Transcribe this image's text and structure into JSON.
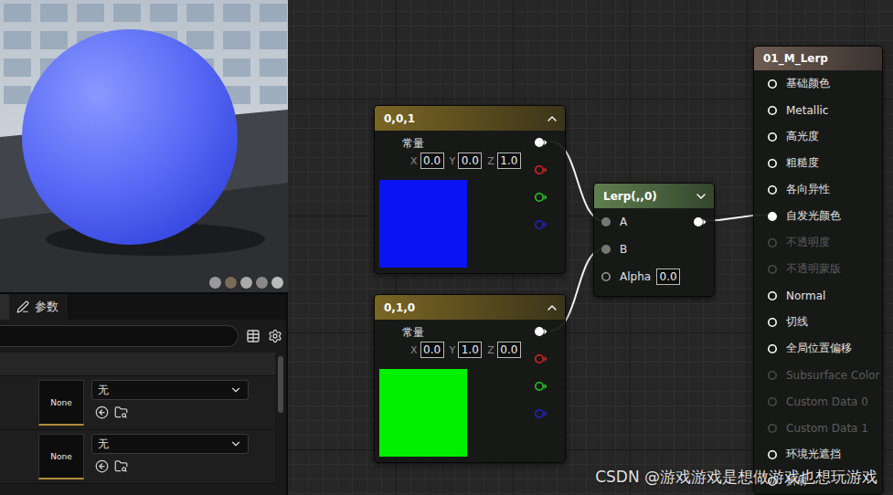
{
  "details": {
    "tabs": [
      {
        "label": "参数",
        "selected": true
      }
    ],
    "rows": [
      {
        "thumbnail": "None",
        "value": "无"
      },
      {
        "thumbnail": "None",
        "value": "无"
      }
    ]
  },
  "graph": {
    "constants": [
      {
        "title": "0,0,1",
        "expanded": true,
        "label": "常量",
        "fields": [
          {
            "axis": "X",
            "value": "0.0"
          },
          {
            "axis": "Y",
            "value": "0.0"
          },
          {
            "axis": "Z",
            "value": "1.0"
          }
        ],
        "color": "#0a14f2"
      },
      {
        "title": "0,1,0",
        "expanded": true,
        "label": "常量",
        "fields": [
          {
            "axis": "X",
            "value": "0.0"
          },
          {
            "axis": "Y",
            "value": "1.0"
          },
          {
            "axis": "Z",
            "value": "0.0"
          }
        ],
        "color": "#00f000"
      }
    ],
    "lerp": {
      "title": "Lerp(,,0)",
      "expanded": false,
      "inputs": [
        {
          "label": "A",
          "connected": true
        },
        {
          "label": "B",
          "connected": true
        },
        {
          "label": "Alpha",
          "connected": false,
          "value": "0.0"
        }
      ]
    },
    "material": {
      "title": "01_M_Lerp",
      "pins": [
        {
          "label": "基础颜色",
          "disabled": false,
          "connected": false
        },
        {
          "label": "Metallic",
          "disabled": false,
          "connected": false
        },
        {
          "label": "高光度",
          "disabled": false,
          "connected": false
        },
        {
          "label": "粗糙度",
          "disabled": false,
          "connected": false
        },
        {
          "label": "各向异性",
          "disabled": false,
          "connected": false
        },
        {
          "label": "自发光颜色",
          "disabled": false,
          "connected": true
        },
        {
          "label": "不透明度",
          "disabled": true,
          "connected": false
        },
        {
          "label": "不透明蒙版",
          "disabled": true,
          "connected": false
        },
        {
          "label": "Normal",
          "disabled": false,
          "connected": false
        },
        {
          "label": "切线",
          "disabled": false,
          "connected": false
        },
        {
          "label": "全局位置偏移",
          "disabled": false,
          "connected": false
        },
        {
          "label": "Subsurface Color",
          "disabled": true,
          "connected": false
        },
        {
          "label": "Custom Data 0",
          "disabled": true,
          "connected": false
        },
        {
          "label": "Custom Data 1",
          "disabled": true,
          "connected": false
        },
        {
          "label": "环境光遮挡",
          "disabled": false,
          "connected": false
        },
        {
          "label": "折射",
          "disabled": false,
          "connected": false
        }
      ]
    }
  },
  "watermark": "CSDN @游戏游戏是想做游戏也想玩游戏"
}
